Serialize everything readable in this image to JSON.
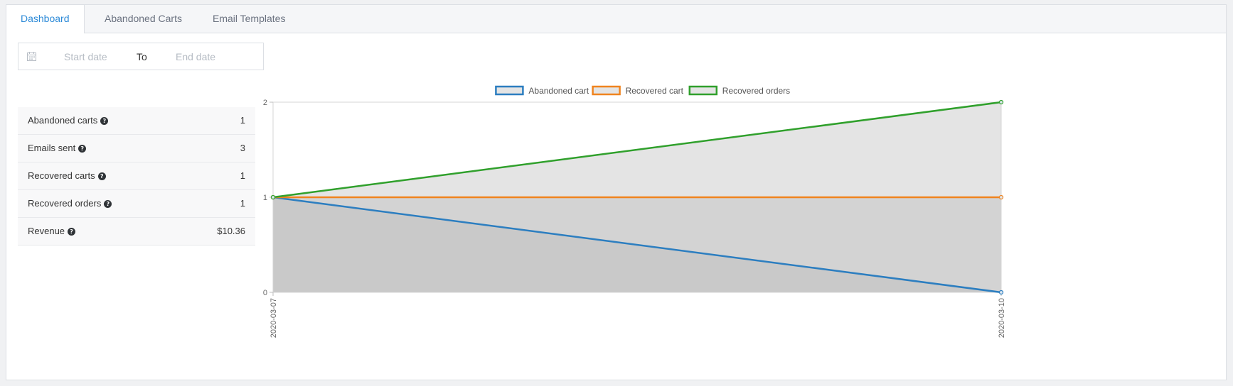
{
  "tabs": [
    {
      "label": "Dashboard",
      "active": true
    },
    {
      "label": "Abandoned Carts",
      "active": false
    },
    {
      "label": "Email Templates",
      "active": false
    }
  ],
  "date_range": {
    "start_placeholder": "Start date",
    "separator": "To",
    "end_placeholder": "End date"
  },
  "stats": [
    {
      "label": "Abandoned carts",
      "value": "1"
    },
    {
      "label": "Emails sent",
      "value": "3"
    },
    {
      "label": "Recovered carts",
      "value": "1"
    },
    {
      "label": "Recovered orders",
      "value": "1"
    },
    {
      "label": "Revenue",
      "value": "$10.36"
    }
  ],
  "chart_data": {
    "type": "area",
    "x": [
      "2020-03-07",
      "2020-03-10"
    ],
    "series": [
      {
        "name": "Abandoned cart",
        "values": [
          1,
          0
        ],
        "color": "#2c7ec0"
      },
      {
        "name": "Recovered cart",
        "values": [
          1,
          1
        ],
        "color": "#f0841f"
      },
      {
        "name": "Recovered orders",
        "values": [
          1,
          2
        ],
        "color": "#30a02c"
      }
    ],
    "ylim": [
      0,
      2
    ],
    "yticks": [
      "0",
      "1",
      "2"
    ],
    "legend": "top",
    "grid": false,
    "fill": "#b8b8b8"
  },
  "colors": {
    "accent": "#2e8bd8"
  }
}
